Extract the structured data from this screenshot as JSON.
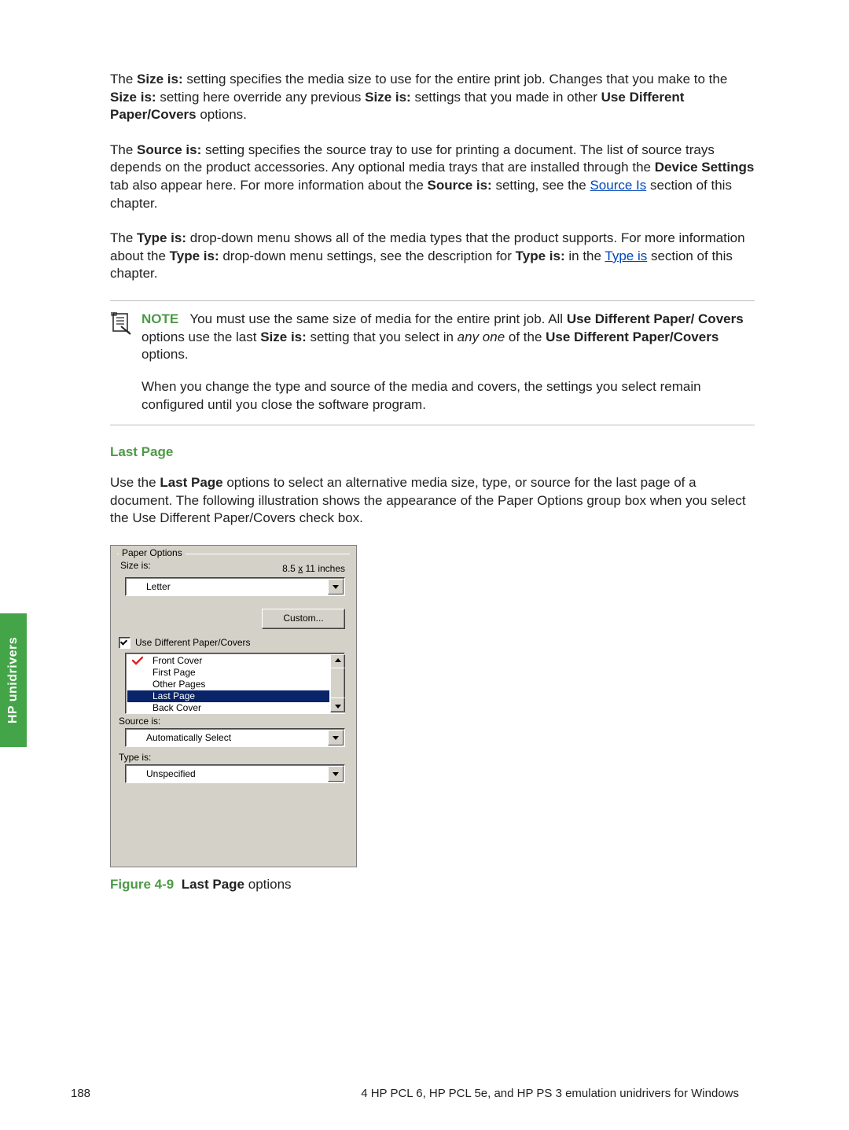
{
  "body": {
    "p1_a": "The ",
    "p1_b": "Size is:",
    "p1_c": " setting specifies the media size to use for the entire print job. Changes that you make to the ",
    "p1_d": "Size is:",
    "p1_e": " setting here override any previous ",
    "p1_f": "Size is:",
    "p1_g": " settings that you made in other ",
    "p1_h": "Use Different Paper/Covers",
    "p1_i": " options.",
    "p2_a": "The ",
    "p2_b": "Source is:",
    "p2_c": " setting specifies the source tray to use for printing a document. The list of source trays depends on the product accessories. Any optional media trays that are installed through the ",
    "p2_d": "Device Settings",
    "p2_e": " tab also appear here. For more information about the ",
    "p2_f": "Source is:",
    "p2_g": " setting, see the ",
    "p2_link1": "Source Is",
    "p2_h": " section of this chapter.",
    "p3_a": "The ",
    "p3_b": "Type is:",
    "p3_c": " drop-down menu shows all of the media types that the product supports. For more information about the ",
    "p3_d": "Type is:",
    "p3_e": " drop-down menu settings, see the description for ",
    "p3_f": "Type is:",
    "p3_g": " in the ",
    "p3_link": "Type is",
    "p3_h": " section of this chapter."
  },
  "note": {
    "lead": "NOTE",
    "p1_a": "You must use the same size of media for the entire print job. All ",
    "p1_b": "Use Different Paper/ Covers",
    "p1_c": " options use the last ",
    "p1_d": "Size is:",
    "p1_e": " setting that you select in ",
    "p1_f": "any one",
    "p1_g": " of the ",
    "p1_h": "Use Different Paper/Covers",
    "p1_i": " options.",
    "p2": "When you change the type and source of the media and covers, the settings you select remain configured until you close the software program."
  },
  "section": {
    "heading": "Last Page",
    "intro_a": "Use the ",
    "intro_b": "Last Page",
    "intro_c": " options to select an alternative media size, type, or source for the last page of a document. The following illustration shows the appearance of the Paper Options group box when you select the Use Different Paper/Covers check box."
  },
  "panel": {
    "legend": "Paper Options",
    "size_label": "Size is:",
    "size_dim": "8.5 x 11 inches",
    "size_value": "Letter",
    "custom_btn": "Custom...",
    "checkbox": "Use Different Paper/Covers",
    "list": {
      "item0": "Front Cover",
      "item1": "First Page",
      "item2": "Other Pages",
      "item3": "Last Page",
      "item4": "Back Cover"
    },
    "source_label": "Source is:",
    "source_value": "Automatically Select",
    "type_label": "Type is:",
    "type_value": "Unspecified"
  },
  "caption": {
    "fig": "Figure 4-9",
    "title": "Last Page",
    "rest": " options"
  },
  "sidetab": "HP unidrivers",
  "footer": {
    "left": "188",
    "right": "4   HP PCL 6, HP PCL 5e, and HP PS 3 emulation unidrivers for Windows"
  }
}
